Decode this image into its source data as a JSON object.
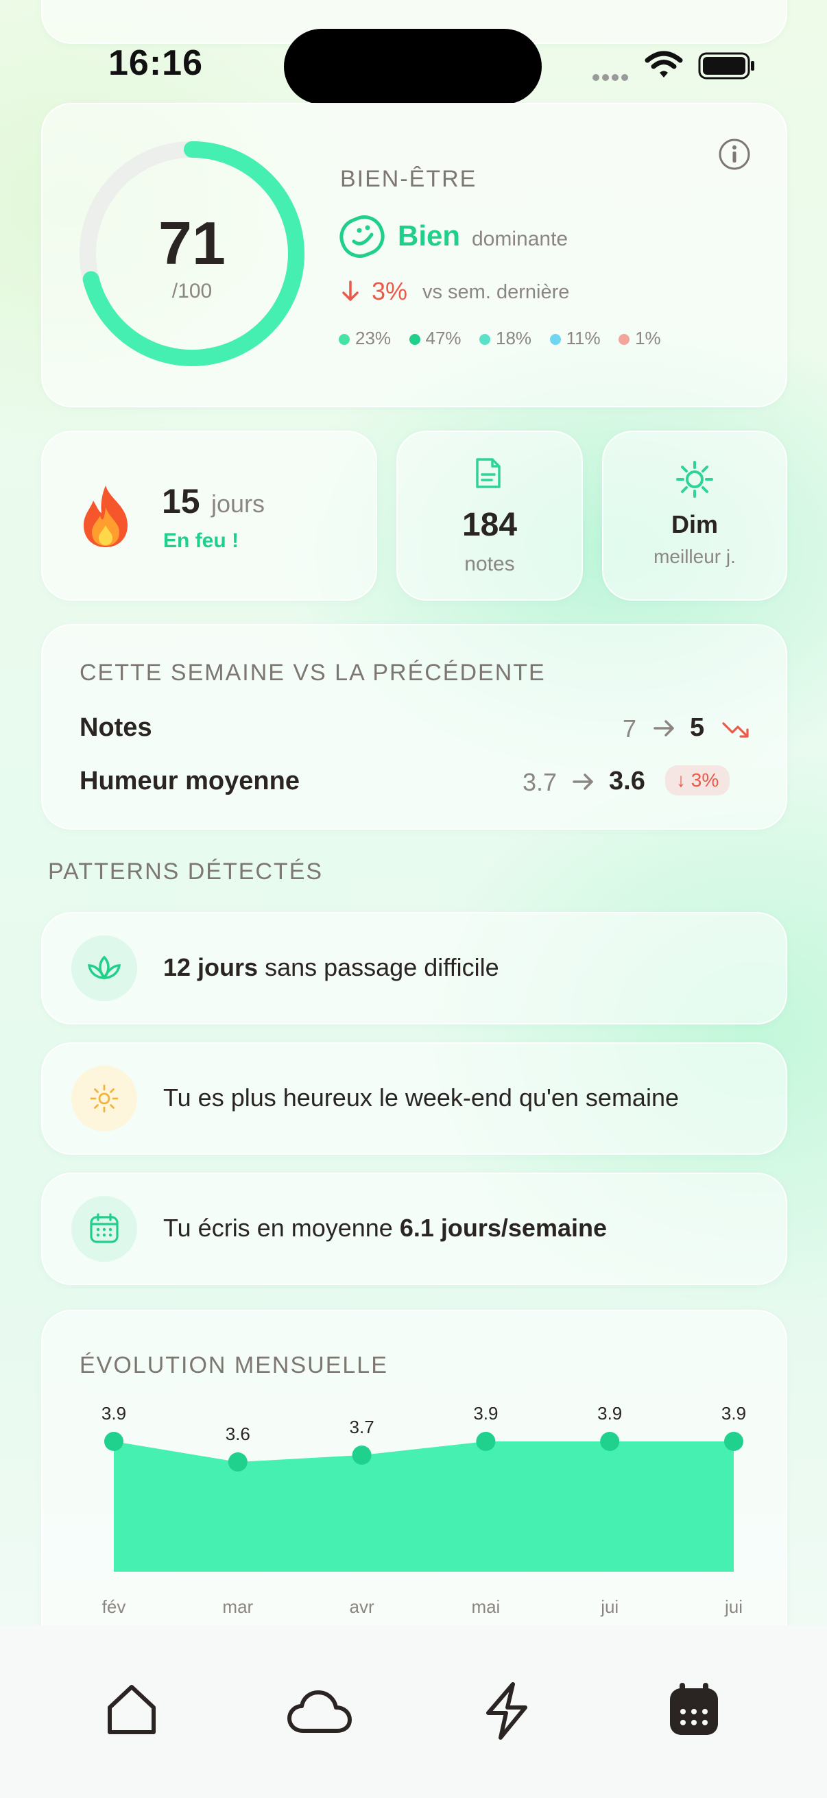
{
  "status_bar": {
    "time": "16:16"
  },
  "score": {
    "value": "71",
    "max": "/100",
    "fraction": 0.71,
    "caption": "BIEN-ÊTRE",
    "mood": "Bien",
    "mood_note": "dominante",
    "delta": "3%",
    "delta_note": "vs sem. dernière",
    "distribution": [
      {
        "pct": "23%",
        "color": "#45e3a6"
      },
      {
        "pct": "47%",
        "color": "#1fcf8a"
      },
      {
        "pct": "18%",
        "color": "#5de0c8"
      },
      {
        "pct": "11%",
        "color": "#6fd5f0"
      },
      {
        "pct": "1%",
        "color": "#f2a59a"
      }
    ]
  },
  "stats": {
    "streak_value": "15",
    "streak_unit": "jours",
    "streak_note": "En feu !",
    "notes_value": "184",
    "notes_label": "notes",
    "best_day_value": "Dim",
    "best_day_label": "meilleur j."
  },
  "compare": {
    "title": "CETTE SEMAINE VS LA PRÉCÉDENTE",
    "rows": [
      {
        "label": "Notes",
        "previous": "7",
        "current": "5"
      },
      {
        "label": "Humeur moyenne",
        "previous": "3.7",
        "current": "3.6",
        "delta": "3%"
      }
    ]
  },
  "patterns": {
    "title": "PATTERNS DÉTECTÉS",
    "items": [
      {
        "bold": "12 jours",
        "text": " sans passage difficile"
      },
      {
        "text": "Tu es plus heureux le week-end qu'en semaine"
      },
      {
        "text": "Tu écris en moyenne ",
        "bold": "6.1 jours/semaine"
      }
    ]
  },
  "chart_data": {
    "type": "area",
    "title": "ÉVOLUTION MENSUELLE",
    "categories": [
      "fév",
      "mar",
      "avr",
      "mai",
      "jui",
      "jui"
    ],
    "values": [
      3.9,
      3.6,
      3.7,
      3.9,
      3.9,
      3.9
    ],
    "labels": [
      "3.9",
      "3.6",
      "3.7",
      "3.9",
      "3.9",
      "3.9"
    ],
    "ylim": [
      0,
      5
    ],
    "grid": false,
    "color": "#45f0b0",
    "point_color": "#1fd18c"
  },
  "colors": {
    "accent": "#1fcf8a",
    "negative": "#ea5a4a"
  }
}
